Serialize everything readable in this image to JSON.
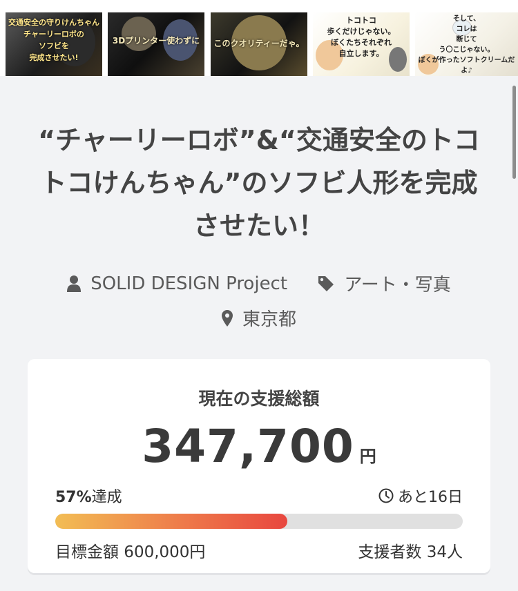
{
  "thumbnails": [
    {
      "caption": "交通安全の守りけんちゃん\nチャーリーロボの\nソフビを\n完成させたい!"
    },
    {
      "caption": "3Dプリンター使わずに"
    },
    {
      "caption": "このクオリティーだゃ。"
    },
    {
      "caption": "トコトコ\n歩くだけじゃない。\nぼくたちそれぞれ\n自立します。"
    },
    {
      "caption": "そして、\nコレは\n断じて\nう〇こじゃない。\nぼくが作ったソフトクリームだよ♪"
    }
  ],
  "title": "“チャーリーロボ”&“交通安全のトコトコけんちゃん”のソフビ人形を完成させたい！",
  "meta": {
    "owner": "SOLID DESIGN Project",
    "category": "アート・写真",
    "location": "東京都",
    "icons": [
      "user-icon",
      "tag-icon",
      "location-pin-icon"
    ]
  },
  "funding": {
    "label": "現在の支援総額",
    "amount": "347,700",
    "currency": "円",
    "achievement_value": "57%",
    "achievement_suffix": "達成",
    "progress": 0.57,
    "remaining": "あと16日",
    "goal": "目標金額 600,000円",
    "backers": "支援者数 34人"
  },
  "colors": {
    "background": "#f2f3f5",
    "progress_start": "#f2bd54",
    "progress_end": "#e8473f",
    "track": "#e0e0e0"
  }
}
